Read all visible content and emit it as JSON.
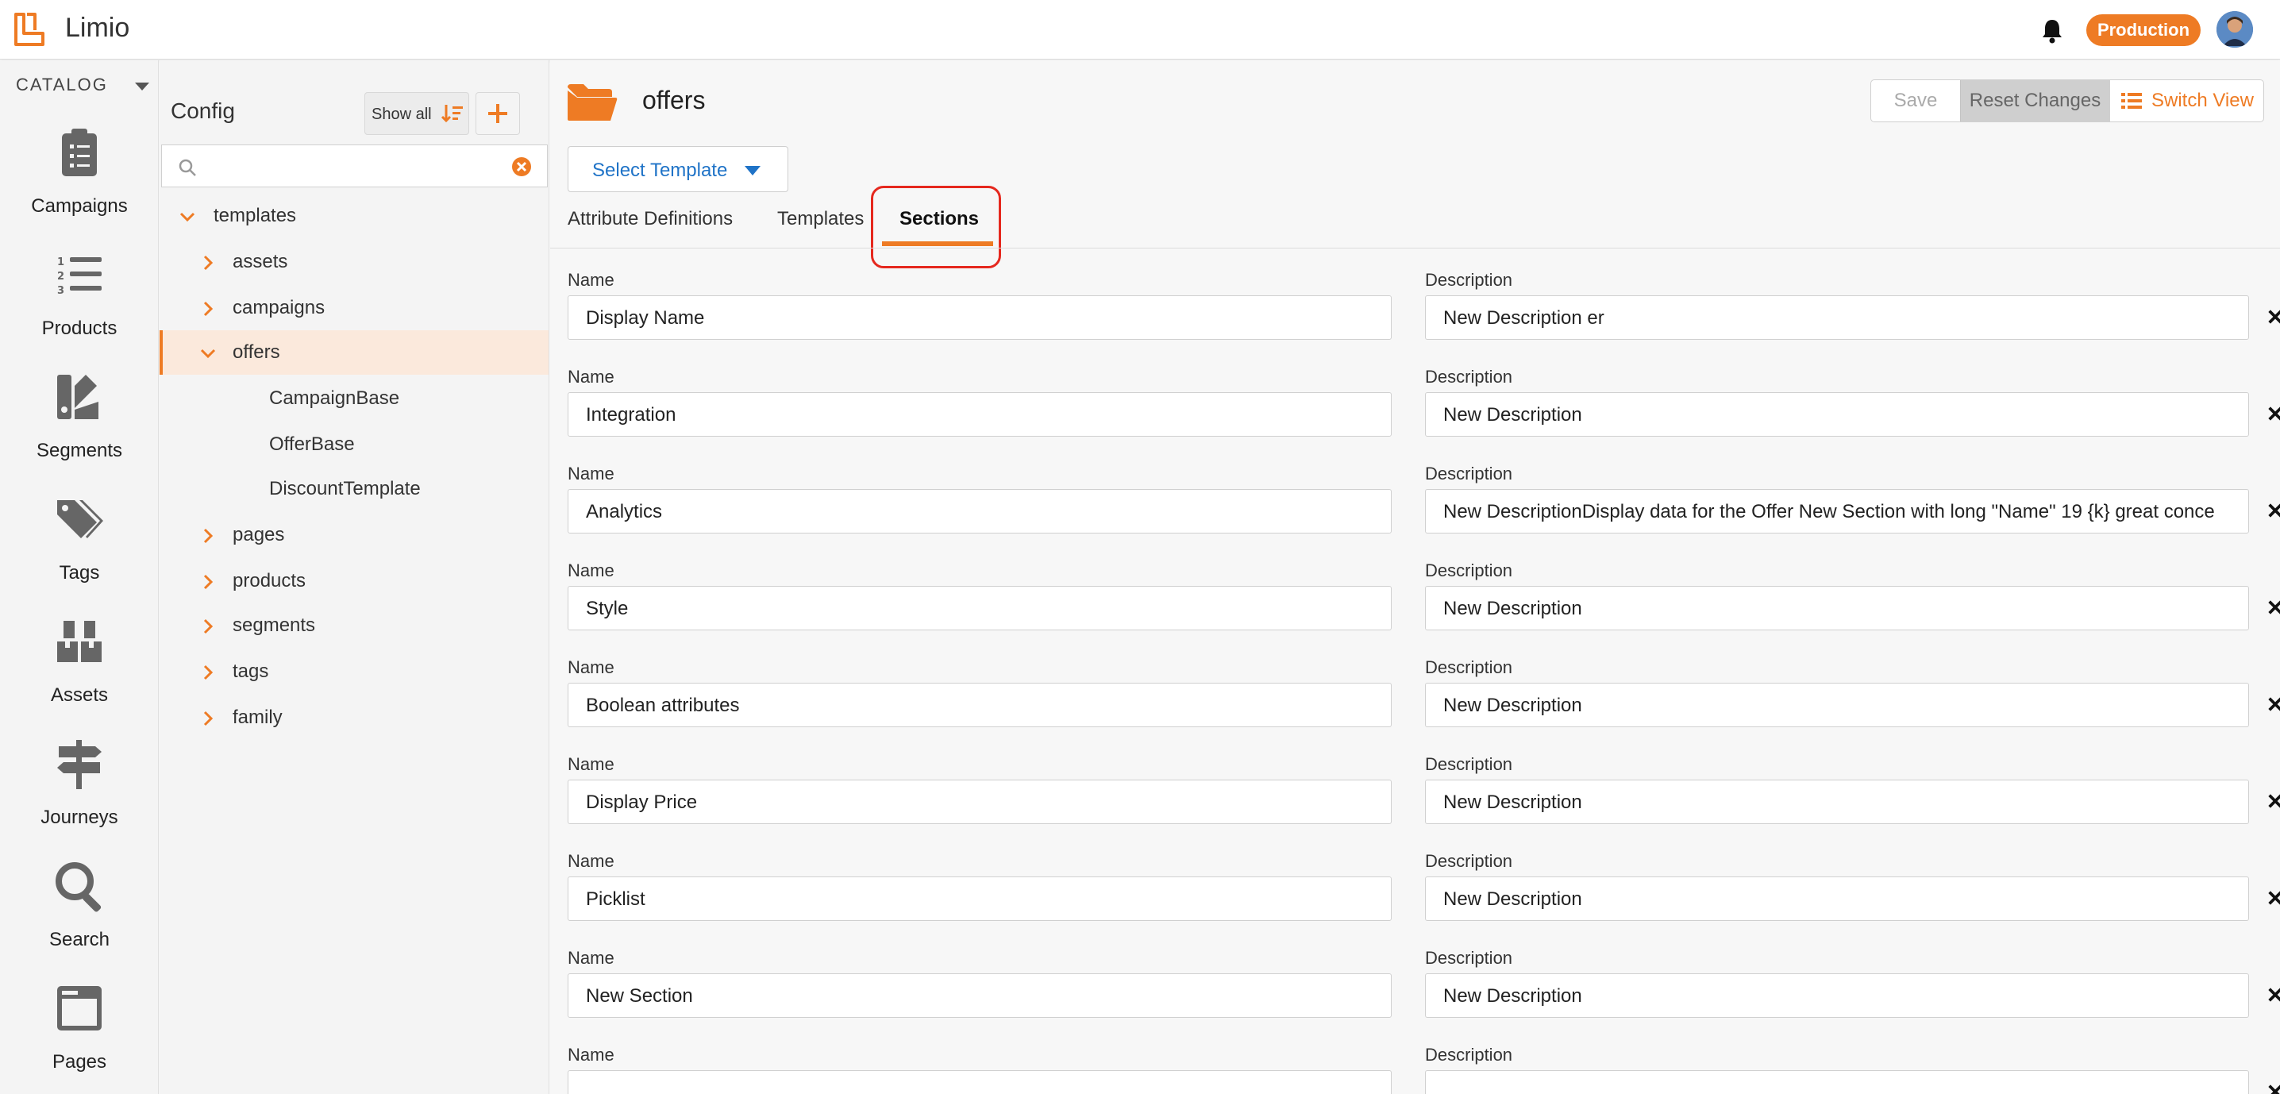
{
  "app": {
    "name": "Limio",
    "environment": "Production"
  },
  "left_nav": {
    "catalog_label": "CATALOG",
    "items": [
      {
        "label": "Campaigns",
        "icon": "clipboard-icon"
      },
      {
        "label": "Products",
        "icon": "numbered-list-icon"
      },
      {
        "label": "Segments",
        "icon": "swatches-icon"
      },
      {
        "label": "Tags",
        "icon": "tags-icon"
      },
      {
        "label": "Assets",
        "icon": "boxes-icon"
      },
      {
        "label": "Journeys",
        "icon": "signpost-icon"
      },
      {
        "label": "Search",
        "icon": "search-icon"
      },
      {
        "label": "Pages",
        "icon": "page-icon"
      }
    ]
  },
  "tree": {
    "title": "Config",
    "show_all_label": "Show all",
    "search_placeholder": "",
    "nodes": [
      {
        "label": "templates",
        "expanded": true
      },
      {
        "label": "assets",
        "expanded": false
      },
      {
        "label": "campaigns",
        "expanded": false
      },
      {
        "label": "offers",
        "expanded": true,
        "selected": true
      },
      {
        "label": "CampaignBase"
      },
      {
        "label": "OfferBase"
      },
      {
        "label": "DiscountTemplate"
      },
      {
        "label": "pages",
        "expanded": false
      },
      {
        "label": "products",
        "expanded": false
      },
      {
        "label": "segments",
        "expanded": false
      },
      {
        "label": "tags",
        "expanded": false
      },
      {
        "label": "family",
        "expanded": false
      }
    ]
  },
  "main": {
    "title": "offers",
    "toolbar": {
      "save": "Save",
      "reset": "Reset Changes",
      "switch_view": "Switch View"
    },
    "select_template": "Select Template",
    "tabs": [
      {
        "label": "Attribute Definitions"
      },
      {
        "label": "Templates"
      },
      {
        "label": "Sections",
        "active": true
      }
    ],
    "name_label": "Name",
    "description_label": "Description",
    "sections": [
      {
        "name": "Display Name",
        "description": "New Description er"
      },
      {
        "name": "Integration",
        "description": "New Description"
      },
      {
        "name": "Analytics",
        "description": "New DescriptionDisplay data for the Offer New Section with long \"Name\" 19 {k} great conce"
      },
      {
        "name": "Style",
        "description": "New Description"
      },
      {
        "name": "Boolean attributes",
        "description": "New Description"
      },
      {
        "name": "Display Price",
        "description": "New Description"
      },
      {
        "name": "Picklist",
        "description": "New Description"
      },
      {
        "name": "New Section",
        "description": "New Description"
      },
      {
        "name": "",
        "description": ""
      }
    ]
  },
  "colors": {
    "accent": "#ee7b24",
    "link": "#1f73c7",
    "highlight": "#e5281e"
  }
}
